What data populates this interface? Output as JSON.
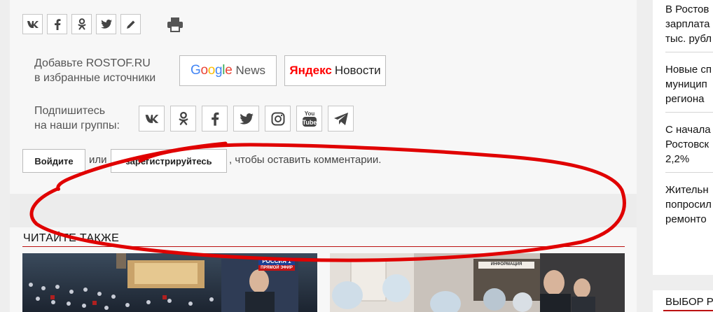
{
  "share": {
    "icons": [
      {
        "name": "vk-share-icon",
        "glyph": "vk"
      },
      {
        "name": "facebook-share-icon",
        "glyph": "f"
      },
      {
        "name": "odnoklassniki-share-icon",
        "glyph": "ok"
      },
      {
        "name": "twitter-share-icon",
        "glyph": "tw"
      },
      {
        "name": "livejournal-share-icon",
        "glyph": "pencil"
      }
    ],
    "print_icon": "printer-icon"
  },
  "news_sources": {
    "label_line1": "Добавьте ROSTOF.RU",
    "label_line2": "в избранные источники",
    "google_news": {
      "google": "Google",
      "news": "News"
    },
    "yandex_news": {
      "yandex": "Яндекс",
      "news": "Новости"
    }
  },
  "groups": {
    "label_line1": "Подпишитесь",
    "label_line2": "на наши группы:",
    "icons": [
      "vk-icon",
      "odnoklassniki-icon",
      "facebook-icon",
      "twitter-icon",
      "instagram-icon",
      "youtube-icon",
      "telegram-icon"
    ]
  },
  "comment": {
    "login_label": "Войдите",
    "or_text": "или",
    "register_label": "зарегистрируйтесь",
    "tail_text": ", чтобы оставить комментарии."
  },
  "see_also": {
    "title": "ЧИТАЙТЕ ТАКЖЕ"
  },
  "photo1": {
    "channel": "РОССИЯ 1",
    "live": "ПРЯМОЙ ЭФИР"
  },
  "photo2": {
    "sign": "ИНФОРМАЦИЯ"
  },
  "sidebar": {
    "items": [
      {
        "lines": [
          "В Ростов",
          "зарплата",
          "тыс. рубл"
        ]
      },
      {
        "lines": [
          "Новые сп",
          "муницип",
          "региона"
        ]
      },
      {
        "lines": [
          "С начала",
          "Ростовск",
          "2,2%"
        ]
      },
      {
        "lines": [
          "Жительн",
          "попросил",
          "ремонто"
        ]
      }
    ],
    "section_title": "ВЫБОР Р"
  },
  "colors": {
    "accent": "#b11111",
    "annotation": "#e00000",
    "google_blue": "#4285F4",
    "google_red": "#EA4335",
    "google_yellow": "#FBBC05",
    "google_green": "#34A853",
    "yandex_red": "#ff0000"
  }
}
